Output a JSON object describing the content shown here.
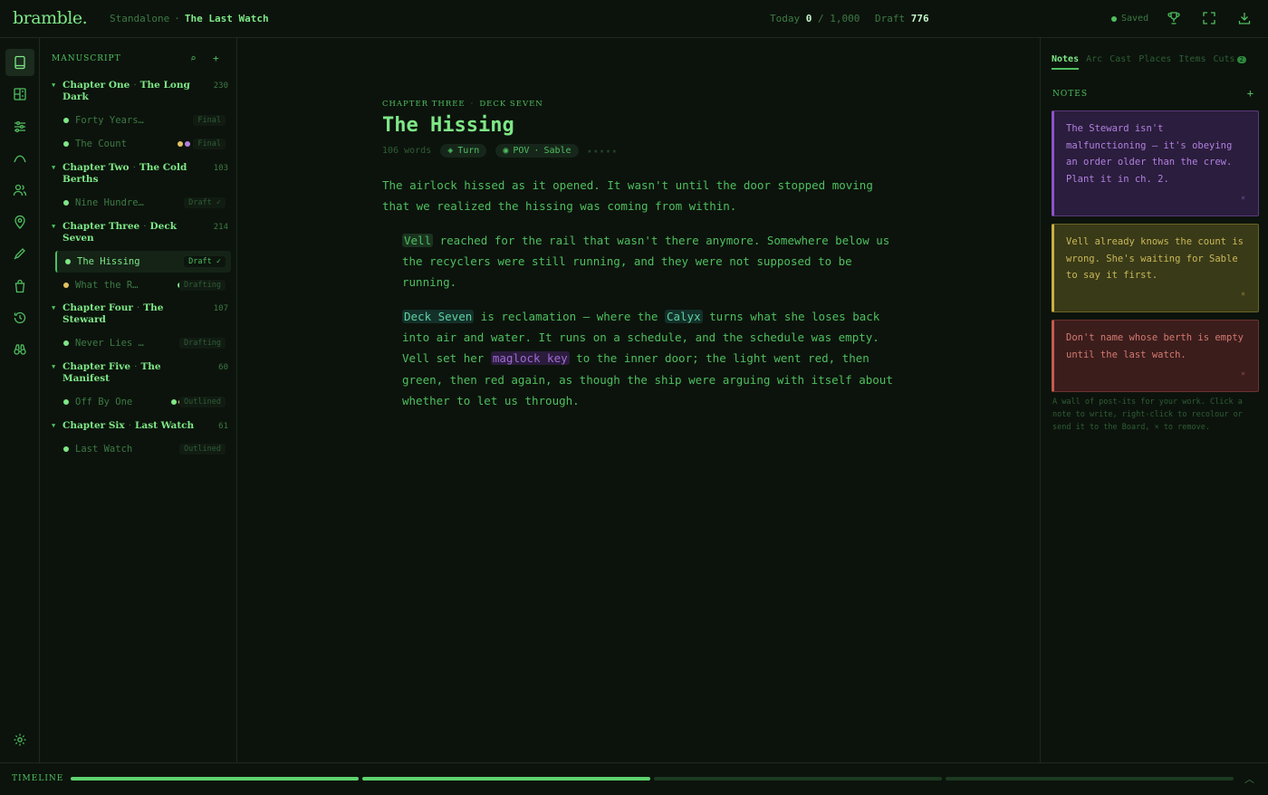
{
  "app": {
    "logo": "bramble.",
    "crumb_project": "Standalone",
    "crumb_sep": "·",
    "crumb_book": "The Last Watch"
  },
  "counts": {
    "today_label": "Today",
    "today_value": "0",
    "today_goal": "/ 1,000",
    "draft_label": "Draft",
    "draft_value": "776"
  },
  "status": {
    "saved_label": "Saved",
    "saved_color": "#4fbf5f"
  },
  "icons": {
    "trophy": "trophy-icon",
    "fullscreen": "fullscreen-icon",
    "download": "download-icon"
  },
  "rail": [
    {
      "name": "manuscript",
      "icon": "book-icon",
      "active": true
    },
    {
      "name": "board",
      "icon": "board-icon",
      "active": false
    },
    {
      "name": "structure",
      "icon": "sliders-icon",
      "active": false
    },
    {
      "name": "arc",
      "icon": "arc-icon",
      "active": false
    },
    {
      "name": "cast",
      "icon": "people-icon",
      "active": false
    },
    {
      "name": "places",
      "icon": "pin-icon",
      "active": false
    },
    {
      "name": "items",
      "icon": "pen-icon",
      "active": false
    },
    {
      "name": "cuts",
      "icon": "bag-icon",
      "active": false
    },
    {
      "name": "history",
      "icon": "history-icon",
      "active": false
    },
    {
      "name": "search",
      "icon": "binoculars-icon",
      "active": false
    },
    {
      "name": "settings",
      "icon": "gear-icon",
      "active": false
    }
  ],
  "manuscript": {
    "heading": "MANUSCRIPT",
    "search_glyph": "⌕",
    "add_glyph": "+",
    "caret": "▼",
    "chapters": [
      {
        "label": "Chapter One",
        "sep": "·",
        "title": "The Long Dark",
        "count": "230",
        "scenes": [
          {
            "title": "Forty Years Out",
            "dot": "#7ee787",
            "pov": [],
            "status": "Final"
          },
          {
            "title": "The Count",
            "dot": "#7ee787",
            "pov": [
              "#e0c060",
              "#b080e0"
            ],
            "status": "Final"
          }
        ]
      },
      {
        "label": "Chapter Two",
        "sep": "·",
        "title": "The Cold Berths",
        "count": "103",
        "scenes": [
          {
            "title": "Nine Hundred…",
            "dot": "#7ee787",
            "pov": [
              "#5fb8d0"
            ],
            "status": "Draft ✓"
          }
        ]
      },
      {
        "label": "Chapter Three",
        "sep": "·",
        "title": "Deck Seven",
        "count": "214",
        "scenes": [
          {
            "title": "The Hissing",
            "dot": "#7ee787",
            "pov": [
              "#e0c060"
            ],
            "status": "Draft ✓",
            "active": true
          },
          {
            "title": "What the R…",
            "dot": "#e0c060",
            "pov": [
              "#7ee787",
              "#b080e0"
            ],
            "status": "Drafting"
          }
        ]
      },
      {
        "label": "Chapter Four",
        "sep": "·",
        "title": "The Steward",
        "count": "107",
        "scenes": [
          {
            "title": "Never Lies …",
            "dot": "#7ee787",
            "pov": [
              "#b080e0"
            ],
            "status": "Drafting"
          }
        ]
      },
      {
        "label": "Chapter Five",
        "sep": "·",
        "title": "The Manifest",
        "count": "60",
        "scenes": [
          {
            "title": "Off By One",
            "dot": "#7ee787",
            "pov": [
              "#7ee787",
              "#e0c060",
              "#b080e0"
            ],
            "status": "Outlined"
          }
        ]
      },
      {
        "label": "Chapter Six",
        "sep": "·",
        "title": "Last Watch",
        "count": "61",
        "scenes": [
          {
            "title": "Last Watch",
            "dot": "#7ee787",
            "pov": [
              "#7ee787"
            ],
            "status": "Outlined"
          }
        ]
      }
    ]
  },
  "editor": {
    "kicker_chapter": "CHAPTER THREE",
    "kicker_sep": "·",
    "kicker_title": "DECK SEVEN",
    "title": "The Hissing",
    "word_count": "106 words",
    "beat_glyph": "◈",
    "beat": "Turn",
    "pov_glyph": "◉",
    "pov_label": "POV",
    "pov_sep": "·",
    "pov_name": "Sable",
    "stars": "★★★★★",
    "p1": "The airlock hissed as it opened. It wasn't until the door stopped moving that we realized the hissing was coming from within.",
    "p2_ent": "Vell",
    "p2_rest": " reached for the rail that wasn't there anymore. Somewhere below us the recyclers were still running, and they were not supposed to be running.",
    "p3_ent1": "Deck Seven",
    "p3_a": " is reclamation — where the ",
    "p3_ent2": "Calyx",
    "p3_b": " turns what she loses back into air and water. It runs on a schedule, and the schedule was empty. Vell set her ",
    "p3_ent3": "maglock key",
    "p3_c": " to the inner door; the light went red, then green, then red again, as though the ship were arguing with itself about whether to let us through."
  },
  "right": {
    "tabs": [
      "Notes",
      "Arc",
      "Cast",
      "Places",
      "Items",
      "Cuts"
    ],
    "cuts_badge": "2",
    "notes_heading": "NOTES",
    "add_glyph": "+",
    "close_glyph": "×",
    "notes": [
      {
        "color": "purple",
        "text": "The Steward isn't malfunctioning — it's obeying an order older than the crew. Plant it in ch. 2."
      },
      {
        "color": "yellow",
        "text": "Vell already knows the count is wrong. She's waiting for Sable to say it first."
      },
      {
        "color": "red",
        "text": "Don't name whose berth is empty until the last watch."
      }
    ],
    "hint": "A wall of post-its for your work. Click a note to write, right-click to recolour or send it to the Board, × to remove."
  },
  "timeline": {
    "label": "TIMELINE",
    "toggle_glyph": "︿",
    "segments": [
      {
        "filled": true
      },
      {
        "filled": true
      },
      {
        "filled": false
      },
      {
        "filled": false
      }
    ],
    "fill_color": "#5ed26e",
    "empty_color": "#1c3a22"
  }
}
